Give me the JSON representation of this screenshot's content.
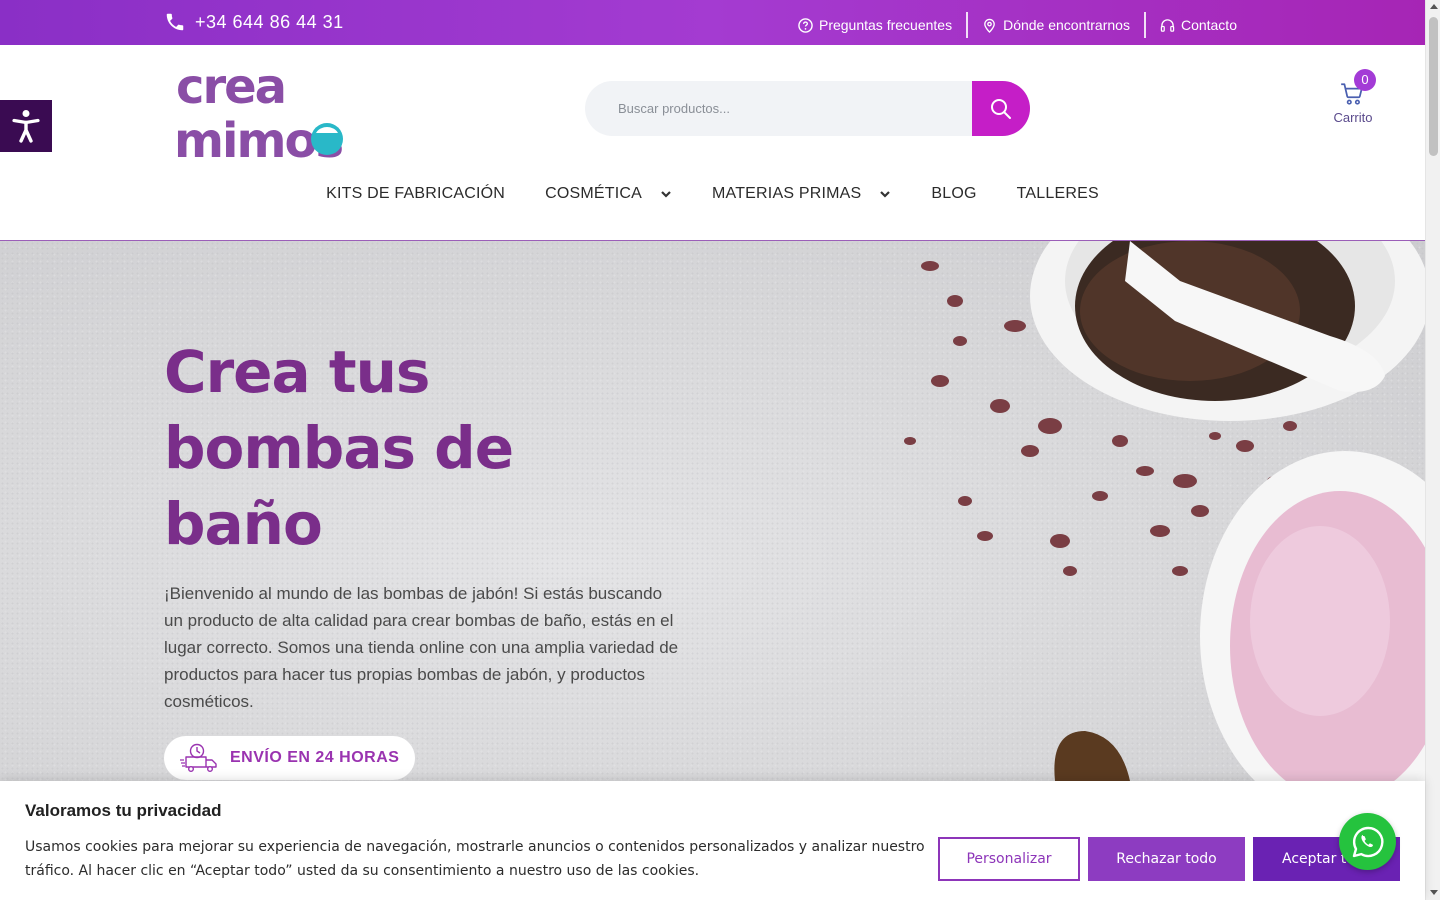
{
  "topbar": {
    "phone": "+34 644 86 44 31",
    "links": [
      "Preguntas frecuentes",
      "Dónde encontrarnos",
      "Contacto"
    ]
  },
  "logo": {
    "line1": "crea",
    "line2": "mimos"
  },
  "search": {
    "placeholder": "Buscar productos..."
  },
  "cart": {
    "count": "0",
    "label": "Carrito"
  },
  "nav": {
    "items": [
      {
        "label": "KITS DE FABRICACIÓN",
        "dropdown": false
      },
      {
        "label": "COSMÉTICA",
        "dropdown": true
      },
      {
        "label": "MATERIAS PRIMAS",
        "dropdown": true
      },
      {
        "label": "BLOG",
        "dropdown": false
      },
      {
        "label": "TALLERES",
        "dropdown": false
      }
    ]
  },
  "hero": {
    "title": "Crea tus bombas de baño",
    "text": "¡Bienvenido al mundo de las bombas de jabón! Si estás buscando un producto de alta calidad para crear bombas de baño, estás en el lugar correcto. Somos una tienda online con una amplia variedad de productos para hacer tus propias bombas de jabón, y productos cosméticos.",
    "shipping": "ENVÍO EN 24 HORAS"
  },
  "cookie": {
    "title": "Valoramos tu privacidad",
    "text": "Usamos cookies para mejorar su experiencia de navegación, mostrarle anuncios o contenidos personalizados y analizar nuestro tráfico. Al hacer clic en “Aceptar todo” usted da su consentimiento a nuestro uso de las cookies.",
    "customize": "Personalizar",
    "reject": "Rechazar todo",
    "accept": "Aceptar todo"
  },
  "colors": {
    "brand_purple": "#7a2e8a",
    "accent_magenta": "#c51ec7",
    "topbar_purple": "#a43bd1",
    "whatsapp_green": "#25c33e"
  }
}
